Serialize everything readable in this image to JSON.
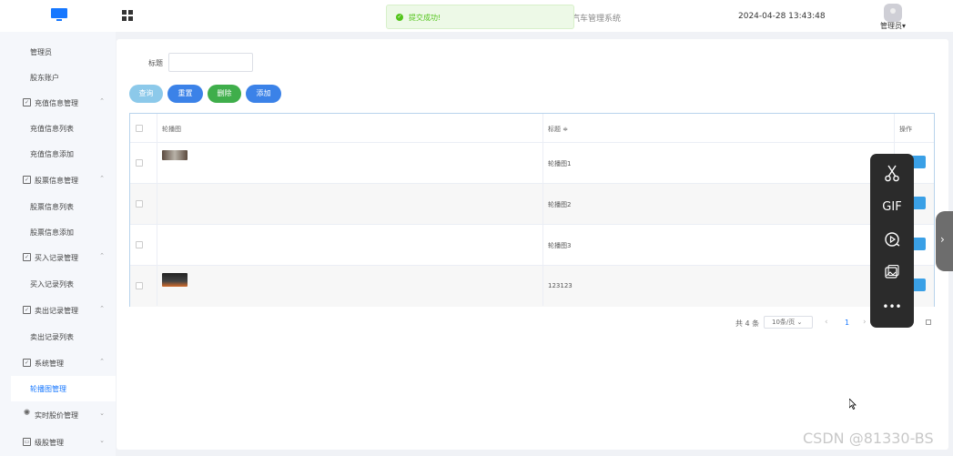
{
  "header": {
    "system_title": "欢迎使用新能源汽车管理系统",
    "datetime": "2024-04-28 13:43:48",
    "user": "管理员",
    "user_caret": "▾"
  },
  "toast": {
    "message": "提交成功!",
    "check": "✓"
  },
  "sidebar": {
    "items": [
      {
        "label": "管理员"
      },
      {
        "label": "股东账户"
      },
      {
        "label": "充值信息管理"
      },
      {
        "label": "充值信息列表"
      },
      {
        "label": "充值信息添加"
      },
      {
        "label": "股票信息管理"
      },
      {
        "label": "股票信息列表"
      },
      {
        "label": "股票信息添加"
      },
      {
        "label": "买入记录管理"
      },
      {
        "label": "买入记录列表"
      },
      {
        "label": "卖出记录管理"
      },
      {
        "label": "卖出记录列表"
      },
      {
        "label": "系统管理"
      },
      {
        "label": "轮播图管理"
      },
      {
        "label": "实时股价管理"
      },
      {
        "label": "级股管理"
      }
    ],
    "chevron_up": "⌃",
    "chevron_down": "⌄"
  },
  "search": {
    "label": "标题",
    "placeholder": ""
  },
  "buttons": {
    "query": "查询",
    "reset": "重置",
    "delete": "删除",
    "add": "添加"
  },
  "table": {
    "headers": {
      "image": "轮播图",
      "title": "标题 ≑",
      "actions": "操作"
    },
    "rows": [
      {
        "title": "轮播图1"
      },
      {
        "title": "轮播图2"
      },
      {
        "title": "轮播图3"
      },
      {
        "title": "123123"
      }
    ]
  },
  "pagination": {
    "total": "共 4 条",
    "page_size": "10条/页 ⌄",
    "prev": "‹",
    "current_page": "1",
    "next": "›"
  },
  "floatbar": {
    "gif": "GIF",
    "more": "•••"
  },
  "sidetab": {
    "arrow": "›"
  },
  "watermark": "CSDN @81330-BS"
}
